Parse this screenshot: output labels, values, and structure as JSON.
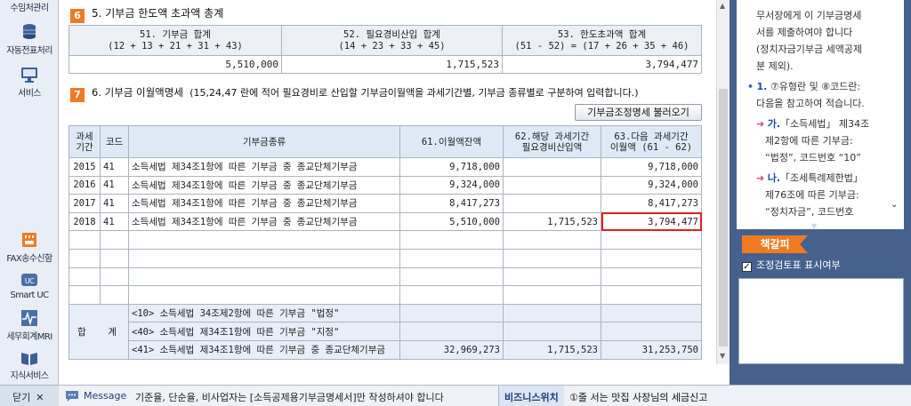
{
  "left_toolbar": {
    "items": [
      {
        "label": "수임처관리",
        "icon": "office-icon"
      },
      {
        "label": "자동전표처리",
        "icon": "database-icon"
      },
      {
        "label": "서비스",
        "icon": "monitor-icon"
      },
      {
        "label": "FAX송수신함",
        "icon": "fax-icon"
      },
      {
        "label": "Smart UC",
        "icon": "uc-icon"
      },
      {
        "label": "세무회계MRI",
        "icon": "pulse-icon"
      },
      {
        "label": "지식서비스",
        "icon": "book-icon"
      }
    ],
    "close_label": "닫기",
    "close_x": "✕"
  },
  "section5": {
    "badge": "6",
    "title": "5. 기부금 한도액 초과액 총계",
    "headers": [
      {
        "line1": "51. 기부금 합계",
        "line2": "(12 + 13 + 21 + 31 + 43)"
      },
      {
        "line1": "52. 필요경비산입 합계",
        "line2": "(14 + 23 + 33 + 45)"
      },
      {
        "line1": "53. 한도초과액 합계",
        "line2": "(51 - 52) = (17 + 26 + 35 + 46)"
      }
    ],
    "values": [
      "5,510,000",
      "1,715,523",
      "3,794,477"
    ]
  },
  "section6": {
    "badge": "7",
    "title": "6. 기부금 이월액명세",
    "note": "(15,24,47 란에 적어 필요경비로 산입할 기부금이월액을 과세기간별, 기부금 종류별로 구분하여 입력합니다.)",
    "load_button": "기부금조정명세 불러오기",
    "headers": {
      "period_1": "과세",
      "period_2": "기간",
      "code": "코드",
      "kind": "기부금종류",
      "col61": "61.이월액잔액",
      "col62_1": "62.해당 과세기간",
      "col62_2": "필요경비산입액",
      "col63_1": "63.다음 과세기간",
      "col63_2": "이월액 (61 - 62)"
    },
    "rows": [
      {
        "year": "2015",
        "code": "41",
        "kind": "소득세법 제34조1항에 따른 기부금 중 종교단체기부금",
        "c61": "9,718,000",
        "c62": "",
        "c63": "9,718,000"
      },
      {
        "year": "2016",
        "code": "41",
        "kind": "소득세법 제34조1항에 따른 기부금 중 종교단체기부금",
        "c61": "9,324,000",
        "c62": "",
        "c63": "9,324,000"
      },
      {
        "year": "2017",
        "code": "41",
        "kind": "소득세법 제34조1항에 따른 기부금 중 종교단체기부금",
        "c61": "8,417,273",
        "c62": "",
        "c63": "8,417,273"
      },
      {
        "year": "2018",
        "code": "41",
        "kind": "소득세법 제34조1항에 따른 기부금 중 종교단체기부금",
        "c61": "5,510,000",
        "c62": "1,715,523",
        "c63": "3,794,477"
      }
    ],
    "totals_label_1": "합",
    "totals_label_2": "계",
    "totals": [
      {
        "kind": "<10> 소득세법 34조제2항에 따른 기부금 \"법정\"",
        "c61": "",
        "c62": "",
        "c63": ""
      },
      {
        "kind": "<40> 소득세법 제34조1항에 따른 기부금 \"지정\"",
        "c61": "",
        "c62": "",
        "c63": ""
      },
      {
        "kind": "<41> 소득세법 제34조1항에 따른 기부금 중 종교단체기부금",
        "c61": "32,969,273",
        "c62": "1,715,523",
        "c63": "31,253,750"
      }
    ]
  },
  "help_panel": {
    "line1": "무서장에게 이 기부금명세",
    "line2": "서를 제출하여야 합니다",
    "line3": "(정치자금기부금 세액공제",
    "line4": "분 제외).",
    "item1_bullet": "1.",
    "item1_line1": "⑦유형란 및 ⑧코드란:",
    "item1_line2": "다음을 참고하여 적습니다.",
    "sub_a_mark": "가.",
    "sub_a_line1": "「소득세법」 제34조",
    "sub_a_line2": "제2항에 따른 기부금:",
    "sub_a_line3": "“법정”, 코드번호 “10”",
    "sub_b_mark": "나.",
    "sub_b_line1": "「조세특례제한법」",
    "sub_b_line2": "제76조에 따른 기부금:",
    "sub_b_line3": "“정치자금”, 코드번호",
    "bookmark": "책갈피",
    "checkbox_label": "조정검토표 표시여부",
    "checkbox_mark": "✓"
  },
  "status_bar": {
    "message_label": "Message",
    "message_text": "기준율, 단순율, 비사업자는 [소득공제용기부금명세서]만 작성하셔야 합니다",
    "biz_label": "비즈니스위치",
    "news_text": "①줄 서는 맛집 사장님의 세금신고"
  }
}
